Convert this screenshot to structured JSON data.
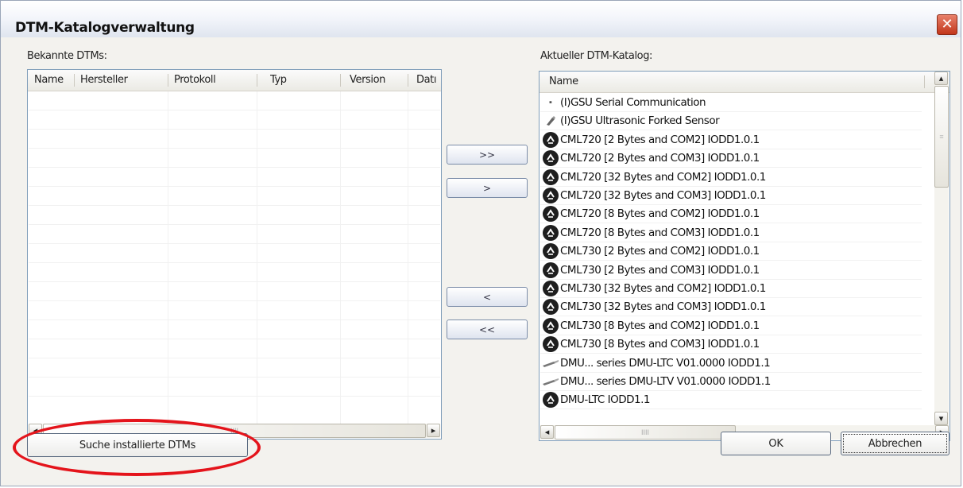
{
  "window": {
    "title": "DTM-Katalogverwaltung",
    "close_glyph": "✕"
  },
  "left_panel": {
    "label": "Bekannte DTMs:",
    "columns": [
      "Name",
      "Hersteller",
      "Protokoll",
      "Typ",
      "Version",
      "Datı"
    ],
    "hscroll_left": "◂",
    "hscroll_right": "▸",
    "hscroll_grip": "IIII"
  },
  "right_panel": {
    "label": "Aktueller DTM-Katalog:",
    "column": "Name",
    "items": [
      {
        "icon": "bullet",
        "text": "(I)GSU Serial Communication"
      },
      {
        "icon": "sensor",
        "text": "(I)GSU Ultrasonic Forked Sensor"
      },
      {
        "icon": "circle",
        "text": "CML720 [2 Bytes and COM2] IODD1.0.1"
      },
      {
        "icon": "circle",
        "text": "CML720 [2 Bytes and COM3] IODD1.0.1"
      },
      {
        "icon": "circle",
        "text": "CML720 [32 Bytes and COM2] IODD1.0.1"
      },
      {
        "icon": "circle",
        "text": "CML720 [32 Bytes and COM3] IODD1.0.1"
      },
      {
        "icon": "circle",
        "text": "CML720 [8 Bytes and COM2] IODD1.0.1"
      },
      {
        "icon": "circle",
        "text": "CML720 [8 Bytes and COM3] IODD1.0.1"
      },
      {
        "icon": "circle",
        "text": "CML730 [2 Bytes and COM2] IODD1.0.1"
      },
      {
        "icon": "circle",
        "text": "CML730 [2 Bytes and COM3] IODD1.0.1"
      },
      {
        "icon": "circle",
        "text": "CML730 [32 Bytes and COM2] IODD1.0.1"
      },
      {
        "icon": "circle",
        "text": "CML730 [32 Bytes and COM3] IODD1.0.1"
      },
      {
        "icon": "circle",
        "text": "CML730 [8 Bytes and COM2] IODD1.0.1"
      },
      {
        "icon": "circle",
        "text": "CML730 [8 Bytes and COM3] IODD1.0.1"
      },
      {
        "icon": "probe",
        "text": "DMU... series DMU-LTC V01.0000 IODD1.1"
      },
      {
        "icon": "probe",
        "text": "DMU... series DMU-LTV V01.0000 IODD1.1"
      },
      {
        "icon": "circle",
        "text": "DMU-LTC IODD1.1"
      }
    ],
    "vscroll_up": "▴",
    "vscroll_down": "▾",
    "vscroll_grip": "≡",
    "hscroll_left": "◂",
    "hscroll_right": "▸",
    "hscroll_grip": "IIII"
  },
  "transfer_buttons": {
    "add_all": ">>",
    "add_one": ">",
    "remove_one": "<",
    "remove_all": "<<"
  },
  "bottom": {
    "search_button": "Suche installierte DTMs",
    "ok_button": "OK",
    "cancel_button": "Abbrechen"
  },
  "colors": {
    "highlight_oval": "#e4141b",
    "close_button": "#c2361b"
  }
}
